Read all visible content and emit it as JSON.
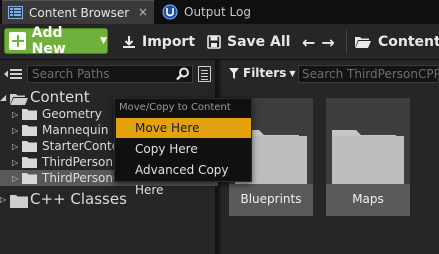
{
  "tabs": [
    {
      "label": "Content Browser",
      "active": true,
      "close": "×"
    },
    {
      "label": "Output Log",
      "active": false
    }
  ],
  "toolbar": {
    "add_new_label": "Add New",
    "import_label": "Import",
    "save_all_label": "Save All",
    "back_glyph": "←",
    "forward_glyph": "→",
    "path_label": "Content"
  },
  "sources": {
    "search_placeholder": "Search Paths",
    "tree": [
      {
        "label": "Content",
        "level": 0,
        "expanded": true,
        "selected": false
      },
      {
        "label": "Geometry",
        "level": 1,
        "expanded": false,
        "selected": false
      },
      {
        "label": "Mannequin",
        "level": 1,
        "expanded": false,
        "selected": false
      },
      {
        "label": "StarterContent",
        "level": 1,
        "expanded": false,
        "selected": false
      },
      {
        "label": "ThirdPerson",
        "level": 1,
        "expanded": false,
        "selected": false
      },
      {
        "label": "ThirdPersonCPP",
        "level": 1,
        "expanded": false,
        "selected": true
      },
      {
        "label": "C++ Classes",
        "level": 0,
        "expanded": false,
        "selected": false
      }
    ]
  },
  "context_menu": {
    "title": "Move/Copy to Content",
    "items": [
      {
        "label": "Move Here",
        "highlighted": true
      },
      {
        "label": "Copy Here",
        "highlighted": false
      },
      {
        "label": "Advanced Copy Here",
        "highlighted": false
      }
    ]
  },
  "assets": {
    "filters_label": "Filters",
    "search_placeholder": "Search ThirdPersonCPP",
    "items": [
      {
        "label": "Blueprints",
        "type": "folder"
      },
      {
        "label": "Maps",
        "type": "folder"
      }
    ]
  },
  "colors": {
    "accent_green": "#6fb13a",
    "menu_highlight": "#e2a20e",
    "panel_bg": "#262626",
    "selection_bg": "#595959"
  },
  "icons": {
    "tab1": "content-browser-icon",
    "tab2": "output-log-icon",
    "import": "download-icon",
    "save": "save-icon",
    "folder": "folder-icon",
    "filter": "funnel-icon"
  }
}
